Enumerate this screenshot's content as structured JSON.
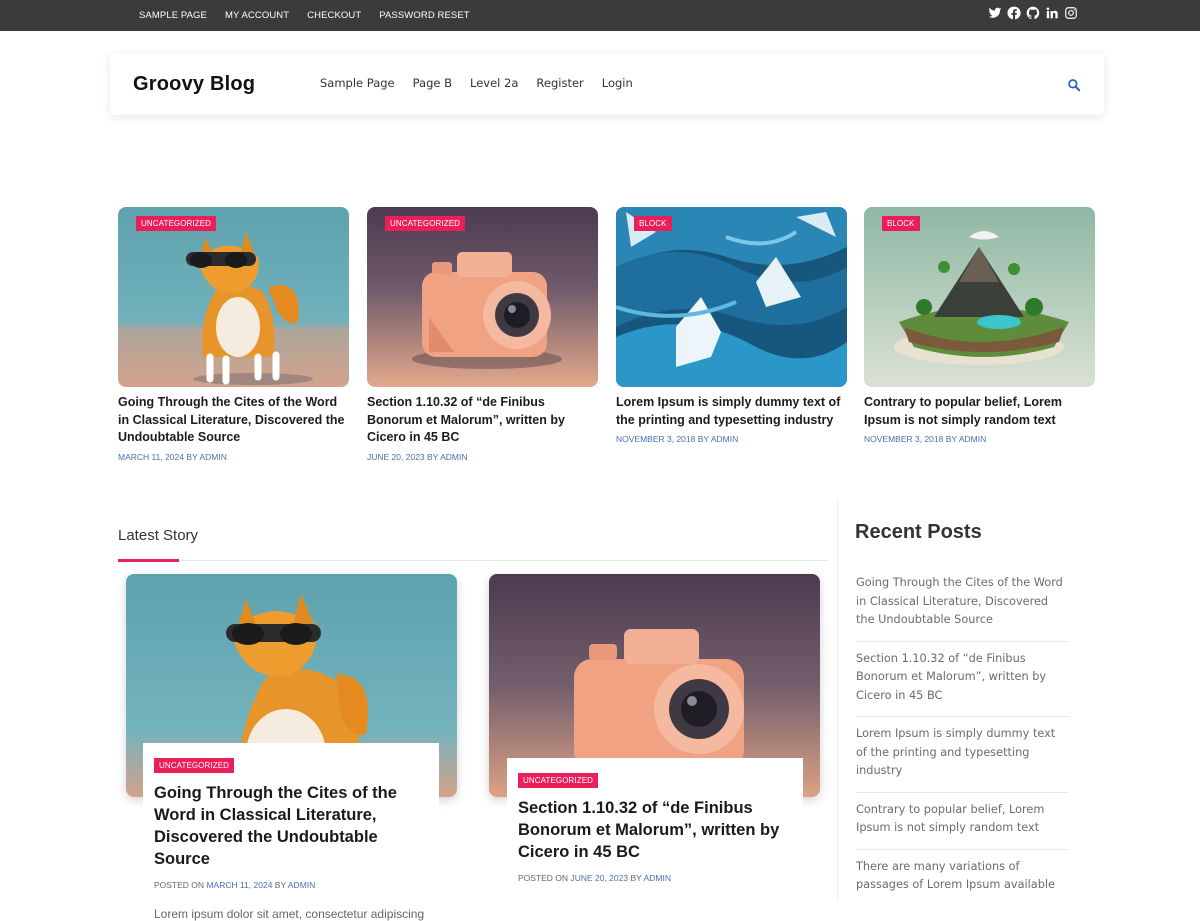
{
  "topbar": {
    "links": [
      "SAMPLE PAGE",
      "MY ACCOUNT",
      "CHECKOUT",
      "PASSWORD RESET"
    ],
    "social_icons": [
      "twitter-icon",
      "facebook-icon",
      "github-icon",
      "linkedin-icon",
      "instagram-icon"
    ]
  },
  "header": {
    "logo": "Groovy Blog",
    "nav": [
      "Sample Page",
      "Page B",
      "Level 2a",
      "Register",
      "Login"
    ],
    "search_icon": "search-icon"
  },
  "featured": [
    {
      "category": "UNCATEGORIZED",
      "title": "Going Through the Cites of the Word in Classical Literature, Discovered the Undoubtable Source",
      "date": "MARCH 11, 2024",
      "by": "BY",
      "author": "ADMIN"
    },
    {
      "category": "UNCATEGORIZED",
      "title": "Section 1.10.32 of “de Finibus Bonorum et Malorum”, written by Cicero in 45 BC",
      "date": "JUNE 20, 2023",
      "by": "BY",
      "author": "ADMIN"
    },
    {
      "category": "BLOCK",
      "title": "Lorem Ipsum is simply dummy text of the printing and typesetting industry",
      "date": "NOVEMBER 3, 2018",
      "by": "BY",
      "author": "ADMIN"
    },
    {
      "category": "BLOCK",
      "title": "Contrary to popular belief, Lorem Ipsum is not simply random text",
      "date": "NOVEMBER 3, 2018",
      "by": "BY",
      "author": "ADMIN"
    }
  ],
  "latest": {
    "heading": "Latest Story",
    "stories": [
      {
        "category": "UNCATEGORIZED",
        "title": "Going Through the Cites of the Word in Classical Literature, Discovered the Undoubtable Source",
        "posted": "POSTED ON",
        "date": "MARCH 11, 2024",
        "by": "BY",
        "author": "ADMIN",
        "excerpt": "Lorem ipsum dolor sit amet, consectetur adipiscing"
      },
      {
        "category": "UNCATEGORIZED",
        "title": "Section 1.10.32 of “de Finibus Bonorum et Malorum”, written by Cicero in 45 BC",
        "posted": "POSTED ON",
        "date": "JUNE 20, 2023",
        "by": "BY",
        "author": "ADMIN"
      }
    ]
  },
  "sidebar": {
    "title": "Recent Posts",
    "posts": [
      "Going Through the Cites of the Word in Classical Literature, Discovered the Undoubtable Source",
      "Section 1.10.32 of “de Finibus Bonorum et Malorum”, written by Cicero in 45 BC",
      "Lorem Ipsum is simply dummy text of the printing and typesetting industry",
      "Contrary to popular belief, Lorem Ipsum is not simply random text",
      "There are many variations of passages of Lorem Ipsum available"
    ]
  },
  "colors": {
    "accent": "#ea1f5a",
    "meta_link": "#4a6fb5",
    "topbar": "#3b3b3b"
  }
}
